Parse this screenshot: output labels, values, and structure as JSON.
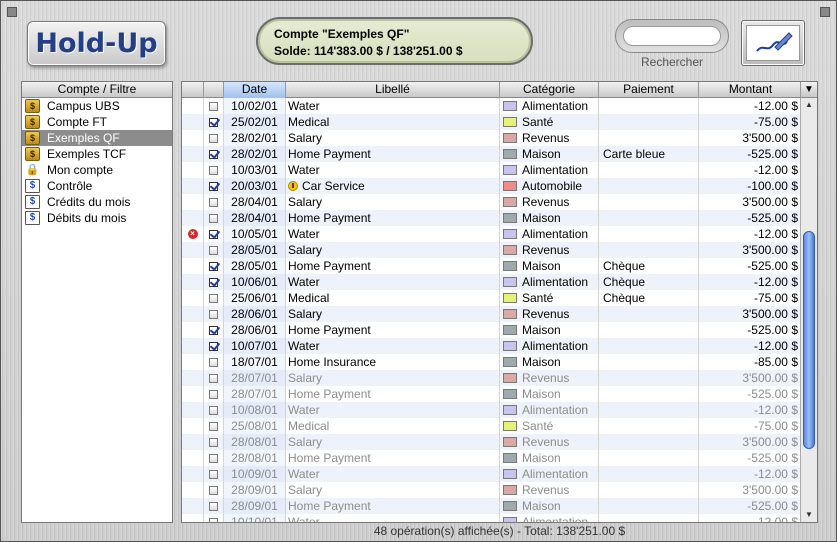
{
  "app": {
    "logo_text": "Hold-Up"
  },
  "account": {
    "title": "Compte \"Exemples QF\"",
    "balance": "Solde: 114'383.00 $  /   138'251.00 $"
  },
  "search": {
    "label": "Rechercher",
    "value": ""
  },
  "left_panel": {
    "header": "Compte / Filtre",
    "items": [
      {
        "label": "Campus UBS",
        "icon": "money-bag-icon",
        "selected": false
      },
      {
        "label": "Compte FT",
        "icon": "money-bag-icon",
        "selected": false
      },
      {
        "label": "Exemples QF",
        "icon": "money-bag-icon",
        "selected": true
      },
      {
        "label": "Exemples TCF",
        "icon": "money-bag-icon",
        "selected": false
      },
      {
        "label": "Mon compte",
        "icon": "lock-icon",
        "selected": false
      },
      {
        "label": "Contrôle",
        "icon": "filter-icon",
        "selected": false
      },
      {
        "label": "Crédits du mois",
        "icon": "filter-icon",
        "selected": false
      },
      {
        "label": "Débits du mois",
        "icon": "filter-icon",
        "selected": false
      }
    ]
  },
  "table": {
    "columns": [
      "Date",
      "Libellé",
      "Catégorie",
      "Paiement",
      "Montant"
    ],
    "category_colors": {
      "Alimentation": "#c8c4ee",
      "Santé": "#e4f27a",
      "Revenus": "#d9aaa4",
      "Maison": "#9eaaae",
      "Automobile": "#ee8c8c"
    },
    "rows": [
      {
        "status": "",
        "checked": false,
        "date": "10/02/01",
        "label": "Water",
        "category": "Alimentation",
        "payment": "",
        "amount": "-12.00 $",
        "dim": false
      },
      {
        "status": "",
        "checked": true,
        "date": "25/02/01",
        "label": "Medical",
        "category": "Santé",
        "payment": "",
        "amount": "-75.00 $",
        "dim": false
      },
      {
        "status": "",
        "checked": false,
        "date": "28/02/01",
        "label": "Salary",
        "category": "Revenus",
        "payment": "",
        "amount": "3'500.00 $",
        "dim": false
      },
      {
        "status": "",
        "checked": true,
        "date": "28/02/01",
        "label": "Home Payment",
        "category": "Maison",
        "payment": "Carte bleue",
        "amount": "-525.00 $",
        "dim": false
      },
      {
        "status": "",
        "checked": false,
        "date": "10/03/01",
        "label": "Water",
        "category": "Alimentation",
        "payment": "",
        "amount": "-12.00 $",
        "dim": false
      },
      {
        "status": "",
        "checked": true,
        "date": "20/03/01",
        "label": "Car Service",
        "category": "Automobile",
        "payment": "",
        "amount": "-100.00 $",
        "dim": false,
        "warn": true
      },
      {
        "status": "",
        "checked": false,
        "date": "28/04/01",
        "label": "Salary",
        "category": "Revenus",
        "payment": "",
        "amount": "3'500.00 $",
        "dim": false
      },
      {
        "status": "",
        "checked": false,
        "date": "28/04/01",
        "label": "Home Payment",
        "category": "Maison",
        "payment": "",
        "amount": "-525.00 $",
        "dim": false
      },
      {
        "status": "error",
        "checked": true,
        "date": "10/05/01",
        "label": "Water",
        "category": "Alimentation",
        "payment": "",
        "amount": "-12.00 $",
        "dim": false
      },
      {
        "status": "",
        "checked": false,
        "date": "28/05/01",
        "label": "Salary",
        "category": "Revenus",
        "payment": "",
        "amount": "3'500.00 $",
        "dim": false
      },
      {
        "status": "",
        "checked": true,
        "date": "28/05/01",
        "label": "Home Payment",
        "category": "Maison",
        "payment": "Chèque",
        "amount": "-525.00 $",
        "dim": false
      },
      {
        "status": "",
        "checked": true,
        "date": "10/06/01",
        "label": "Water",
        "category": "Alimentation",
        "payment": "Chèque",
        "amount": "-12.00 $",
        "dim": false
      },
      {
        "status": "",
        "checked": false,
        "date": "25/06/01",
        "label": "Medical",
        "category": "Santé",
        "payment": "Chèque",
        "amount": "-75.00 $",
        "dim": false
      },
      {
        "status": "",
        "checked": false,
        "date": "28/06/01",
        "label": "Salary",
        "category": "Revenus",
        "payment": "",
        "amount": "3'500.00 $",
        "dim": false
      },
      {
        "status": "",
        "checked": true,
        "date": "28/06/01",
        "label": "Home Payment",
        "category": "Maison",
        "payment": "",
        "amount": "-525.00 $",
        "dim": false
      },
      {
        "status": "",
        "checked": true,
        "date": "10/07/01",
        "label": "Water",
        "category": "Alimentation",
        "payment": "",
        "amount": "-12.00 $",
        "dim": false
      },
      {
        "status": "",
        "checked": false,
        "date": "18/07/01",
        "label": "Home Insurance",
        "category": "Maison",
        "payment": "",
        "amount": "-85.00 $",
        "dim": false
      },
      {
        "status": "",
        "checked": false,
        "date": "28/07/01",
        "label": "Salary",
        "category": "Revenus",
        "payment": "",
        "amount": "3'500.00 $",
        "dim": true
      },
      {
        "status": "",
        "checked": false,
        "date": "28/07/01",
        "label": "Home Payment",
        "category": "Maison",
        "payment": "",
        "amount": "-525.00 $",
        "dim": true
      },
      {
        "status": "",
        "checked": false,
        "date": "10/08/01",
        "label": "Water",
        "category": "Alimentation",
        "payment": "",
        "amount": "-12.00 $",
        "dim": true
      },
      {
        "status": "",
        "checked": false,
        "date": "25/08/01",
        "label": "Medical",
        "category": "Santé",
        "payment": "",
        "amount": "-75.00 $",
        "dim": true
      },
      {
        "status": "",
        "checked": false,
        "date": "28/08/01",
        "label": "Salary",
        "category": "Revenus",
        "payment": "",
        "amount": "3'500.00 $",
        "dim": true
      },
      {
        "status": "",
        "checked": false,
        "date": "28/08/01",
        "label": "Home Payment",
        "category": "Maison",
        "payment": "",
        "amount": "-525.00 $",
        "dim": true
      },
      {
        "status": "",
        "checked": false,
        "date": "10/09/01",
        "label": "Water",
        "category": "Alimentation",
        "payment": "",
        "amount": "-12.00 $",
        "dim": true
      },
      {
        "status": "",
        "checked": false,
        "date": "28/09/01",
        "label": "Salary",
        "category": "Revenus",
        "payment": "",
        "amount": "3'500.00 $",
        "dim": true
      },
      {
        "status": "",
        "checked": false,
        "date": "28/09/01",
        "label": "Home Payment",
        "category": "Maison",
        "payment": "",
        "amount": "-525.00 $",
        "dim": true
      },
      {
        "status": "",
        "checked": false,
        "date": "10/10/01",
        "label": "Water",
        "category": "Alimentation",
        "payment": "",
        "amount": "-12.00 $",
        "dim": true
      }
    ]
  },
  "scroll": {
    "thumb_start": 0.3,
    "thumb_fraction": 0.55
  },
  "status_bar": "48 opération(s) affichée(s) - Total: 138'251.00 $"
}
